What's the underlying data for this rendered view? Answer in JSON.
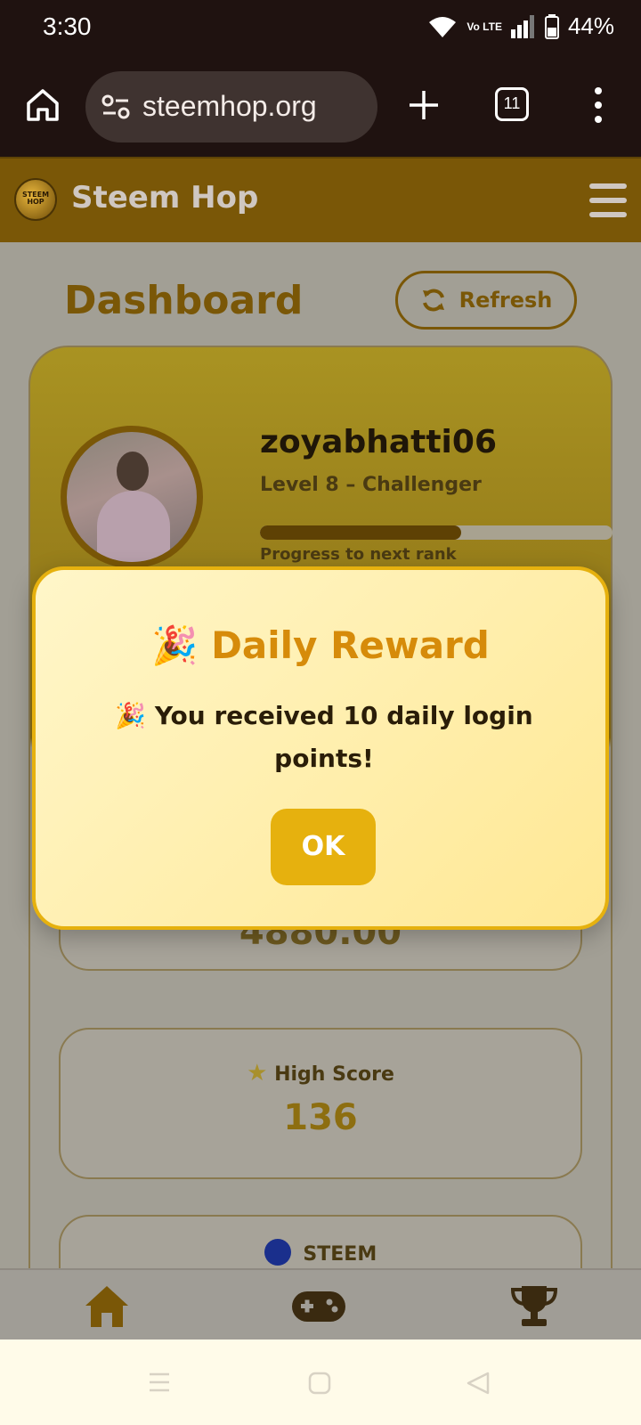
{
  "status": {
    "time": "3:30",
    "battery": "44%",
    "network": "Vo LTE"
  },
  "browser": {
    "url": "steemhop.org",
    "tab_count": "11"
  },
  "header": {
    "brand": "Steem Hop",
    "logo_text": "STEEM HOP"
  },
  "dashboard": {
    "title": "Dashboard",
    "refresh_label": "Refresh",
    "profile": {
      "username": "zoyabhatti06",
      "level": "Level 8 – Challenger",
      "progress_label": "Progress to next rank",
      "progress_percent": 57
    },
    "points_value": "4880.00",
    "high_score_label": "High Score",
    "high_score_value": "136",
    "steem_label": "STEEM"
  },
  "modal": {
    "title": "🎉 Daily Reward",
    "message": "🎉 You received 10 daily login points!",
    "ok_label": "OK"
  },
  "bottom_nav": {
    "items": [
      "home-icon",
      "gamepad-icon",
      "trophy-icon"
    ]
  },
  "colors": {
    "primary": "#7a5707",
    "accent": "#e6b10e",
    "title": "#d68b0a"
  }
}
